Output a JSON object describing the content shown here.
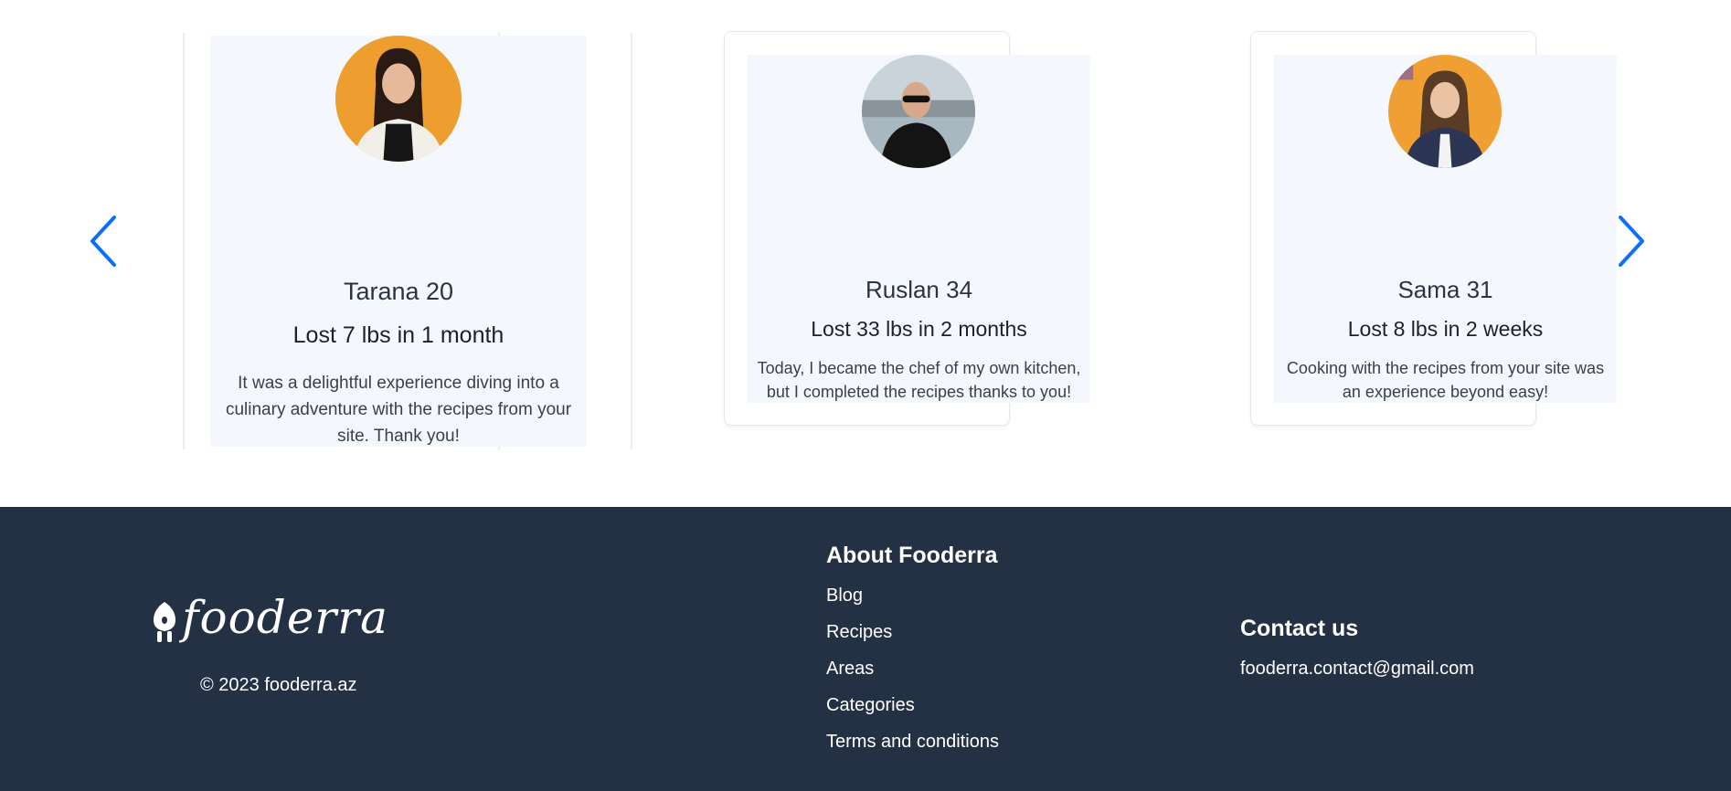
{
  "carousel": {
    "testimonials": [
      {
        "name": "Tarana 20",
        "result": "Lost 7 lbs in 1 month",
        "quote": "It was a delightful experience diving into a culinary adventure with the recipes from your site. Thank you!"
      },
      {
        "name": "Ruslan 34",
        "result": "Lost 33 lbs in 2 months",
        "quote": "Today, I became the chef of my own kitchen, but I completed the recipes thanks to you!"
      },
      {
        "name": "Sama 31",
        "result": "Lost 8 lbs in 2 weeks",
        "quote": "Cooking with the recipes from your site was an experience beyond easy!"
      }
    ],
    "arrow_color": "#0d6efd",
    "prev_icon": "chevron-left-icon",
    "next_icon": "chevron-right-icon"
  },
  "footer": {
    "logo_text": "fooderra",
    "copyright": "© 2023 fooderra.az",
    "about": {
      "title": "About Fooderra",
      "links": [
        "Blog",
        "Recipes",
        "Areas",
        "Categories",
        "Terms and conditions"
      ]
    },
    "contact": {
      "title": "Contact us",
      "email": "fooderra.contact@gmail.com"
    },
    "background": "#243144"
  }
}
